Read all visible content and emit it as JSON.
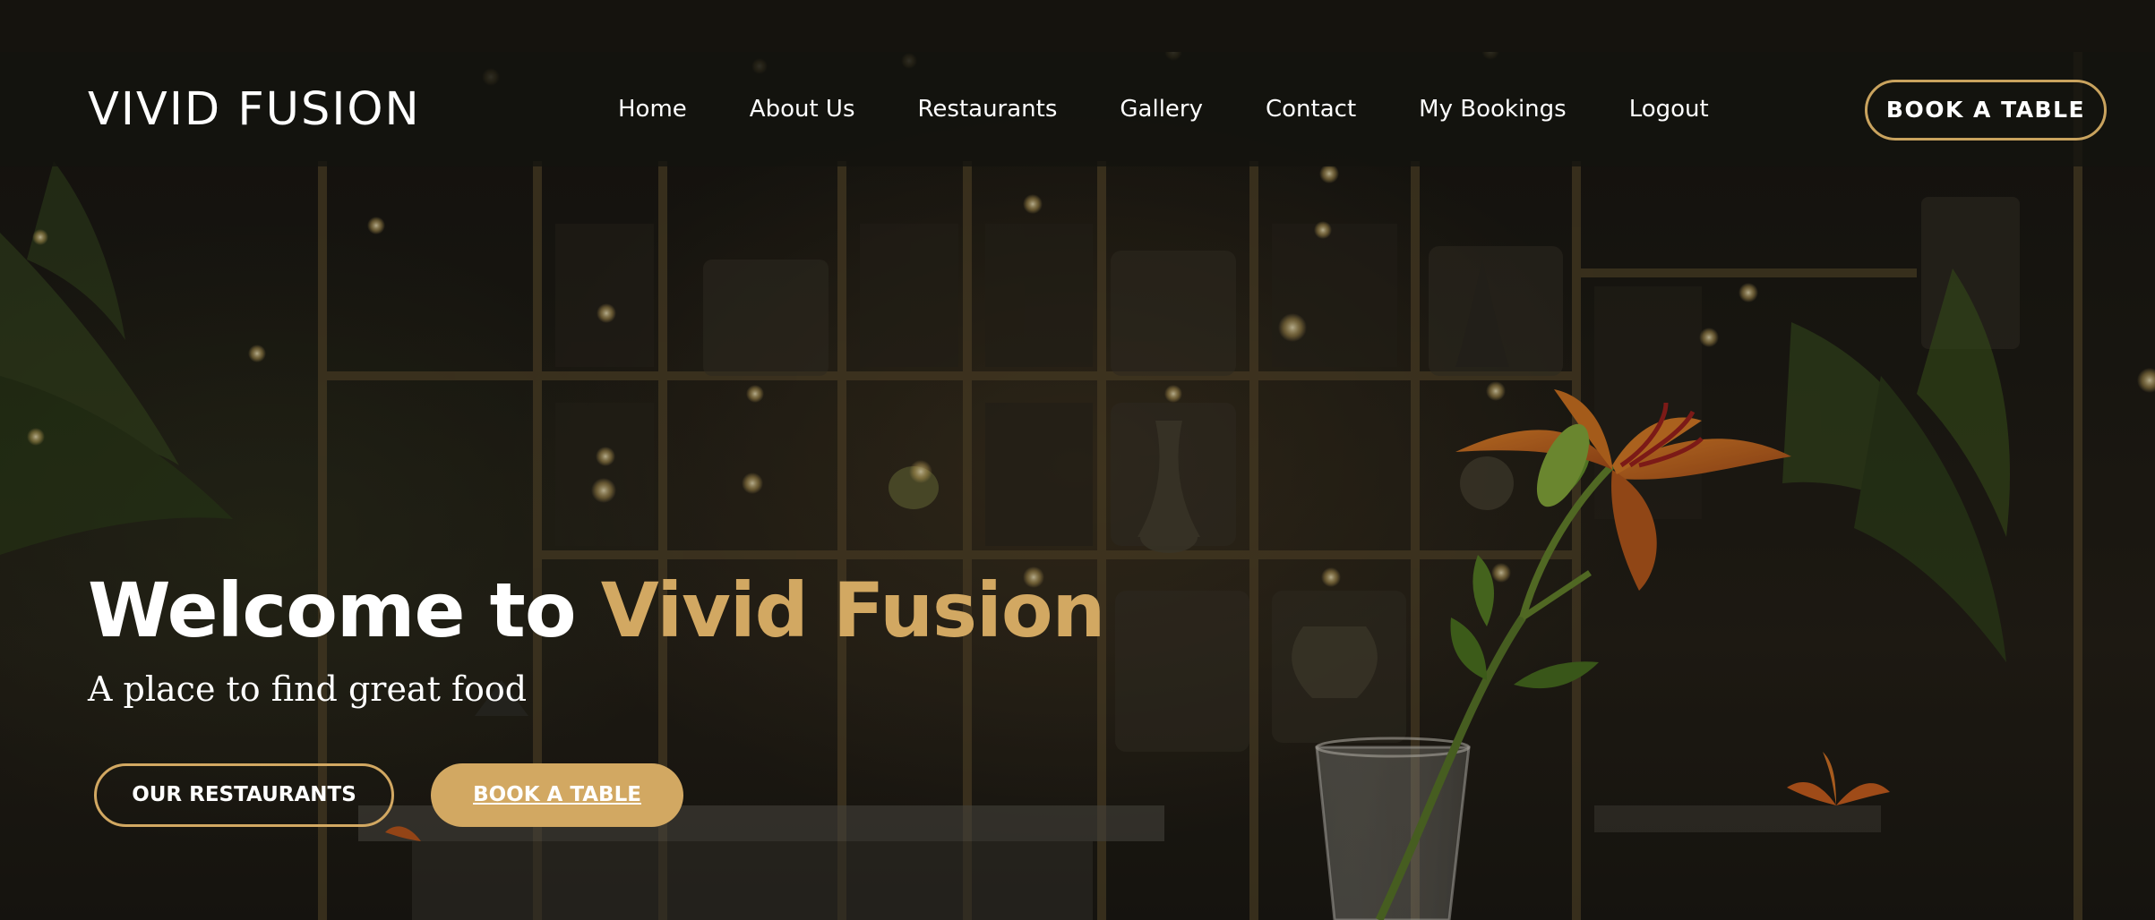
{
  "brand": {
    "name": "VIVID FUSION"
  },
  "nav": {
    "items": [
      {
        "label": "Home"
      },
      {
        "label": "About Us"
      },
      {
        "label": "Restaurants"
      },
      {
        "label": "Gallery"
      },
      {
        "label": "Contact"
      },
      {
        "label": "My Bookings"
      },
      {
        "label": "Logout"
      }
    ],
    "cta_label": "BOOK A TABLE"
  },
  "hero": {
    "headline_prefix": "Welcome to ",
    "headline_highlight": "Vivid Fusion",
    "subtitle": "A place to find great food",
    "primary_button": "OUR RESTAURANTS",
    "secondary_button": "BOOK A TABLE"
  },
  "colors": {
    "accent": "#d2a862",
    "nav_background": "#14130f",
    "text": "#ffffff"
  }
}
